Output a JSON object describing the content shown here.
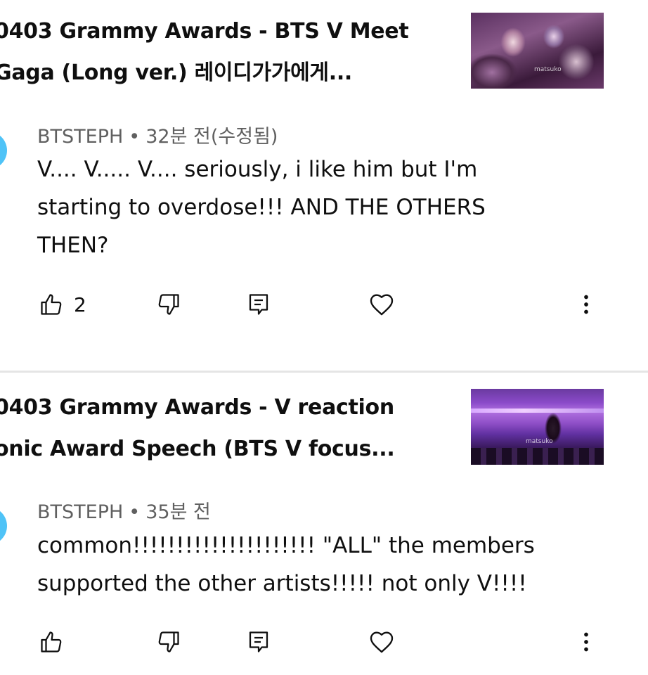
{
  "comments": [
    {
      "video_title_lines": [
        "0403 Grammy Awards - BTS V Meet",
        "Gaga (Long ver.) 레이디가가에게..."
      ],
      "author": "BTSTEPH",
      "separator": "•",
      "time": "32분 전(수정됨)",
      "text_lines": [
        "V.... V..... V.... seriously, i like him but  I'm",
        "starting to overdose!!! AND THE OTHERS",
        "THEN?"
      ],
      "like_count": "2",
      "thumbnail_mark": "matsuko"
    },
    {
      "video_title_lines": [
        "0403 Grammy Awards - V reaction",
        "onic Award Speech (BTS V focus..."
      ],
      "author": "BTSTEPH",
      "separator": "•",
      "time": "35분 전",
      "text_lines": [
        "common!!!!!!!!!!!!!!!!!!!!! \"ALL\" the members",
        "supported the other artists!!!!! not only V!!!!"
      ],
      "like_count": "",
      "thumbnail_mark": "matsuko"
    }
  ],
  "icons": {
    "like": "thumbs-up-icon",
    "dislike": "thumbs-down-icon",
    "reply": "reply-comment-icon",
    "heart": "heart-icon",
    "more": "more-vertical-icon"
  },
  "colors": {
    "avatar": "#4fc3f7",
    "meta_text": "#606060",
    "divider": "#e5e5e5"
  }
}
